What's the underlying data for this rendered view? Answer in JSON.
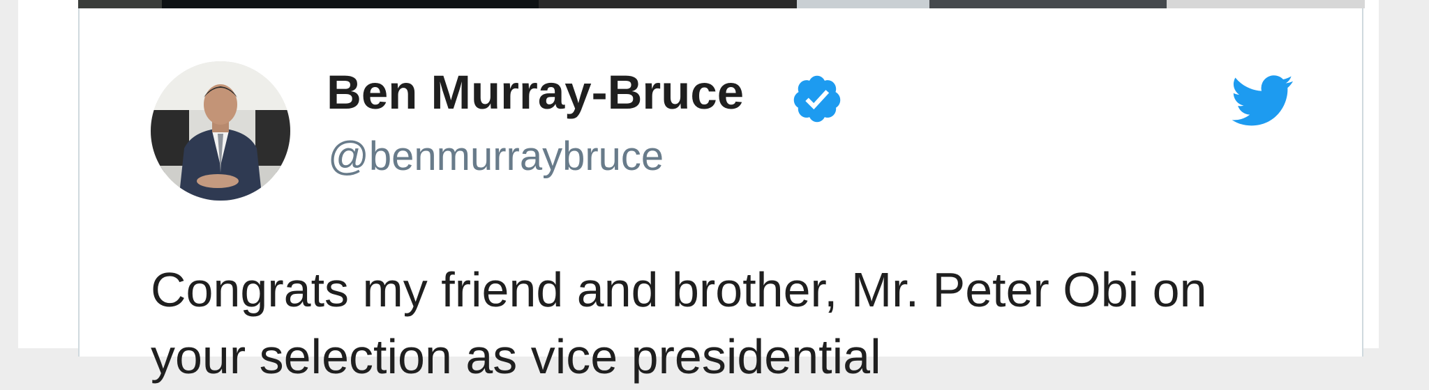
{
  "tweet": {
    "author": {
      "display_name": "Ben Murray-Bruce",
      "handle": "@benmurraybruce",
      "verified": true
    },
    "text": "Congrats my friend and brother, Mr. Peter Obi on your selection as vice presidential"
  },
  "icons": {
    "verified": "verified-badge-icon",
    "brand": "twitter-bird-icon"
  },
  "colors": {
    "twitter_blue": "#1d9bf0",
    "handle_gray": "#687b8a",
    "text_dark": "#1f1f1f"
  }
}
